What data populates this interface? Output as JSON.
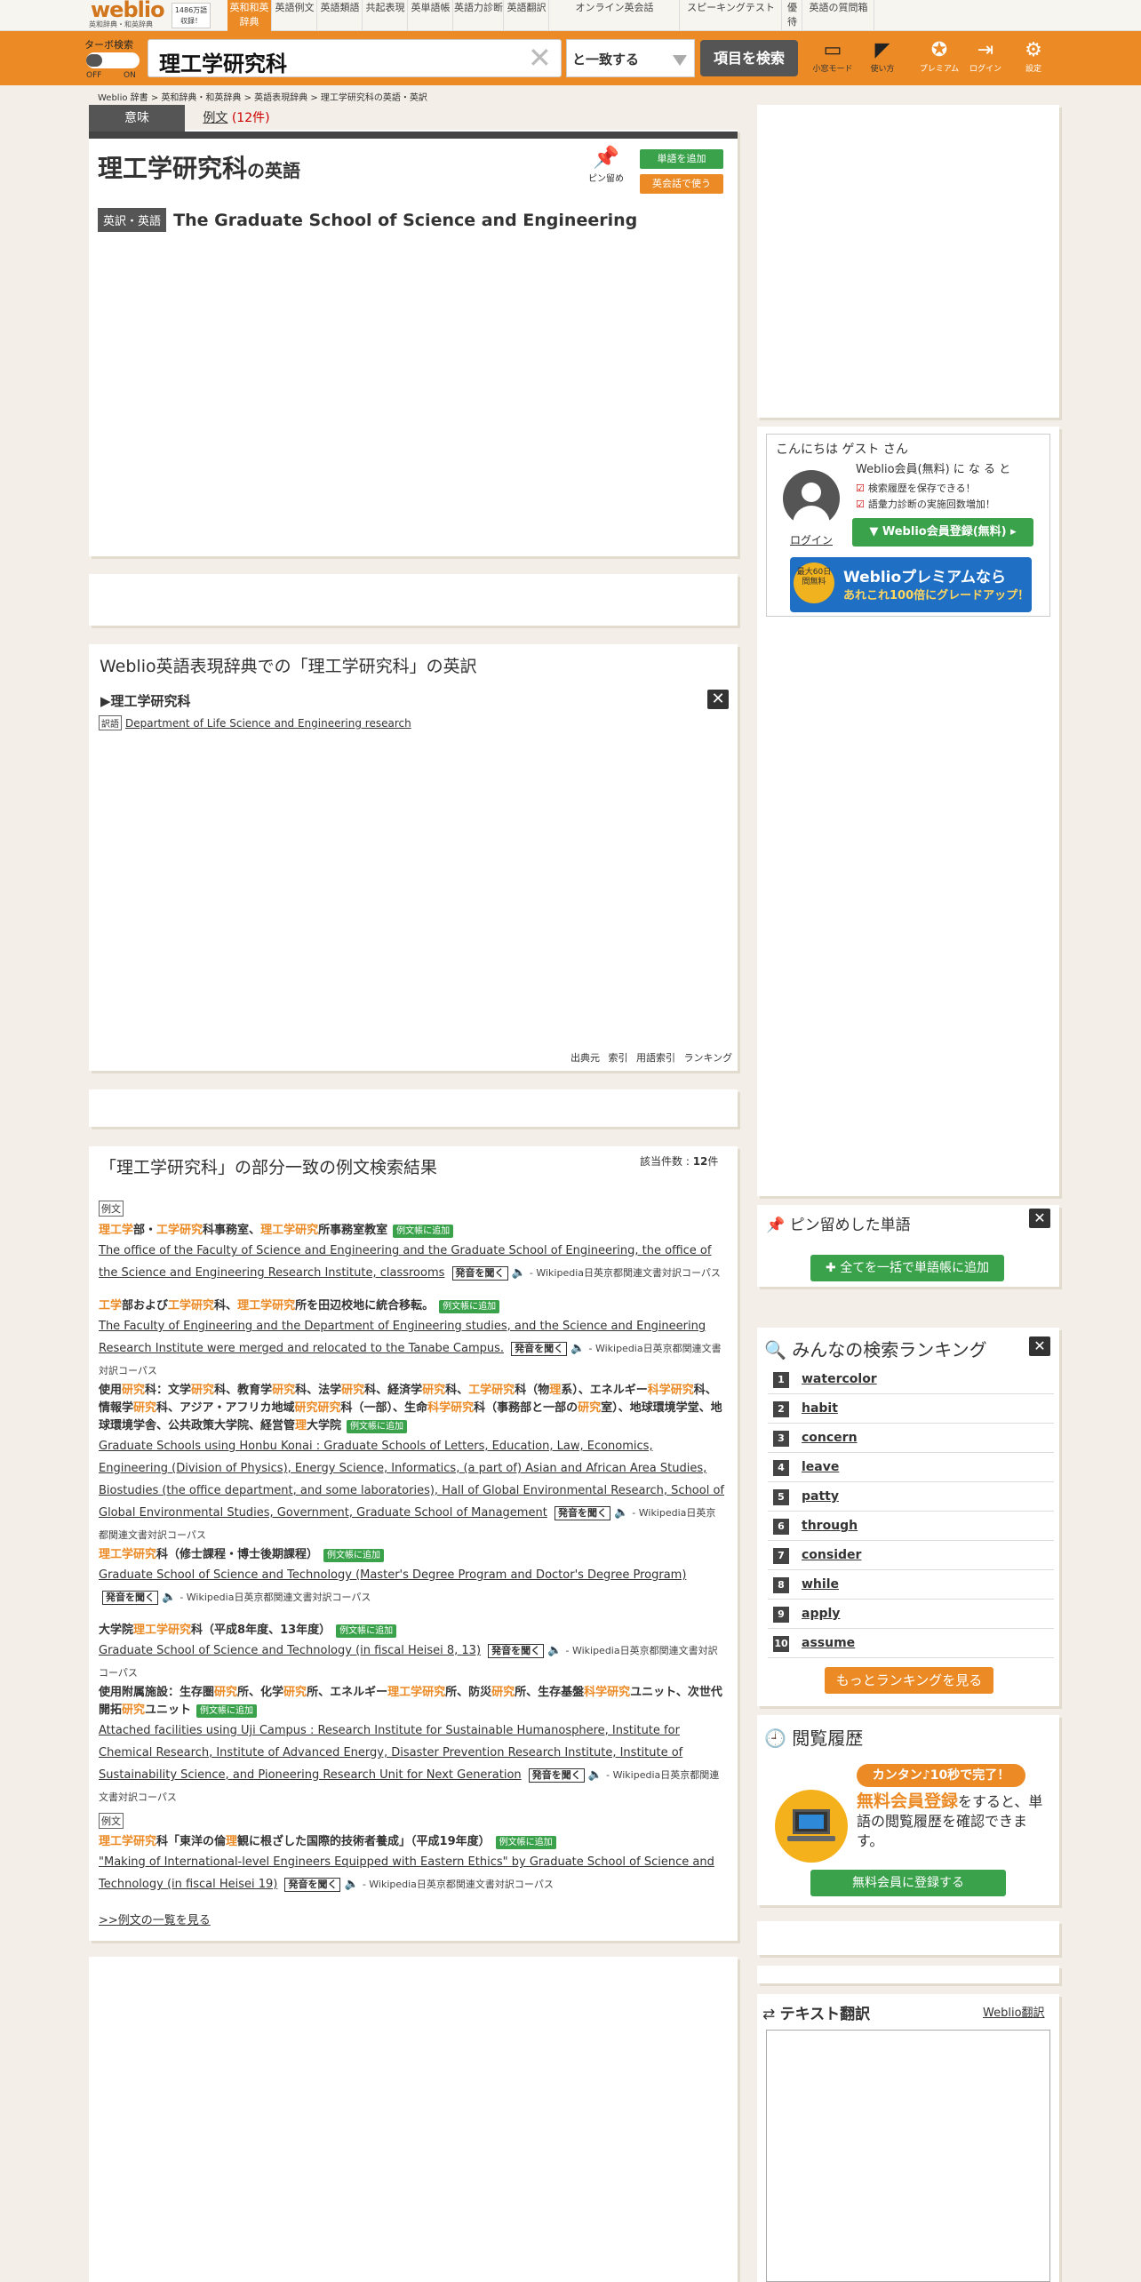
{
  "header": {
    "logo": "weblio",
    "logo_sub": "英和辞典・和英辞典",
    "badge_line1": "1486万語",
    "badge_line2": "収録！",
    "nav": [
      "英和和英辞典",
      "英語例文",
      "英語類語",
      "共起表現",
      "英単語帳",
      "英語力診断",
      "英語翻訳",
      "オンライン英会話",
      "スピーキングテスト",
      "優待",
      "英語の質問箱"
    ]
  },
  "search": {
    "turbo_label": "ターボ検索",
    "off": "OFF",
    "on": "ON",
    "query": "理工学研究科",
    "mode": "と一致する",
    "button": "項目を検索",
    "tools": [
      "小窓モード",
      "使い方",
      "プレミアム",
      "ログイン",
      "設定"
    ]
  },
  "breadcrumb": [
    "Weblio 辞書",
    "英和辞典・和英辞典",
    "英語表現辞典",
    "理工学研究科の英語・英訳"
  ],
  "tabs": {
    "meaning": "意味",
    "examples": "例文",
    "examples_count": "(12件)"
  },
  "entry": {
    "title": "理工学研究科",
    "title_suffix": "の英語",
    "pin": "ピン留め",
    "add_word": "単語を追加",
    "conversation": "英会話で使う",
    "tag": "英訳・英語",
    "translation": "The Graduate School of Science and Engineering"
  },
  "expression": {
    "title": "Weblio英語表現辞典での「理工学研究科」の英訳",
    "word": "▶理工学研究科",
    "label": "訳語",
    "translation": "Department of Life Science and Engineering research",
    "links": [
      "出典元",
      "索引",
      "用語索引",
      "ランキング"
    ]
  },
  "examples": {
    "title": "「理工学研究科」の部分一致の例文検索結果",
    "count_label": "該当件数 : ",
    "count": "12",
    "count_unit": "件",
    "label": "例文",
    "add": "例文帳に追加",
    "audio": "発音を聞く",
    "source": "- Wikipedia日英京都関連文書対訳コーパス",
    "more": ">>例文の一覧を見る",
    "items": [
      {
        "ja": "理工学部・工学研究科事務室、理工学研究所事務室教室",
        "en": "The office of the Faculty of Science and Engineering and the Graduate School of Engineering, the office of the Science and Engineering Research Institute, classrooms"
      },
      {
        "ja": "工学部および工学研究科、理工学研究所を田辺校地に統合移転。",
        "en": "The Faculty of Engineering and the Department of Engineering studies, and the Science and Engineering Research Institute were merged and relocated to the Tanabe Campus."
      },
      {
        "ja": "使用研究科：文学研究科、教育学研究科、法学研究科、経済学研究科、工学研究科（物理系）、エネルギー科学研究科、情報学研究科、アジア・アフリカ地域研究研究科（一部）、生命科学研究科（事務部と一部の研究室）、地球環境学堂、地球環境学舎、公共政策大学院、経営管理大学院",
        "en": "Graduate Schools using Honbu Konai : Graduate Schools of Letters, Education, Law, Economics, Engineering (Division of Physics), Energy Science, Informatics, (a part of) Asian and African Area Studies, Biostudies (the office department, and some laboratories), Hall of Global Environmental Research, School of Global Environmental Studies, Government, Graduate School of Management"
      },
      {
        "ja": "理工学研究科（修士課程・博士後期課程）",
        "en": "Graduate School of Science and Technology (Master's Degree Program and Doctor's Degree Program)"
      },
      {
        "ja": "大学院理工学研究科（平成8年度、13年度）",
        "en": "Graduate School of Science and Technology (in fiscal Heisei 8, 13)"
      },
      {
        "ja": "使用附属施設：生存圏研究所、化学研究所、エネルギー理工学研究所、防災研究所、生存基盤科学研究ユニット、次世代開拓研究ユニット",
        "en": "Attached facilities using Uji Campus : Research Institute for Sustainable Humanosphere, Institute for Chemical Research, Institute of Advanced Energy, Disaster Prevention Research Institute, Institute of Sustainability Science, and Pioneering Research Unit for Next Generation"
      },
      {
        "ja": "理工学研究科「東洋の倫理観に根ざした国際的技術者養成」（平成19年度）",
        "en": "\"Making of International-level Engineers Equipped with Eastern Ethics\" by Graduate School of Science and Technology (in fiscal Heisei 19)"
      }
    ]
  },
  "sidebar": {
    "greeting": "こんにちは ゲスト さん",
    "member": "Weblio会員(無料) に な る と",
    "check1": "検索履歴を保存できる！",
    "check2": "語彙力診断の実施回数増加！",
    "login": "ログイン",
    "register": "Weblio会員登録(無料)",
    "premium_badge": "最大60日間無料",
    "premium1": "Weblioプレミアムなら",
    "premium2": "あれこれ100倍にグレードアップ！",
    "pinned_title": "ピン留めした単語",
    "pinned_button": "全てを一括で単語帳に追加",
    "ranking_title": "みんなの検索ランキング",
    "ranking": [
      "watercolor",
      "habit",
      "concern",
      "leave",
      "patty",
      "through",
      "consider",
      "while",
      "apply",
      "assume"
    ],
    "ranking_more": "もっとランキングを見る",
    "history_title": "閲覧履歴",
    "history_promo": "カンタン♪10秒で完了！",
    "history_text1": "無料会員登録",
    "history_text2": "をすると、単語の閲覧履歴を確認できます。",
    "history_button": "無料会員に登録する",
    "translate_title": "テキスト翻訳",
    "translate_link": "Weblio翻訳"
  },
  "colors": {
    "accent": "#ec8b26",
    "green": "#3ba24c",
    "dark": "#555555"
  }
}
